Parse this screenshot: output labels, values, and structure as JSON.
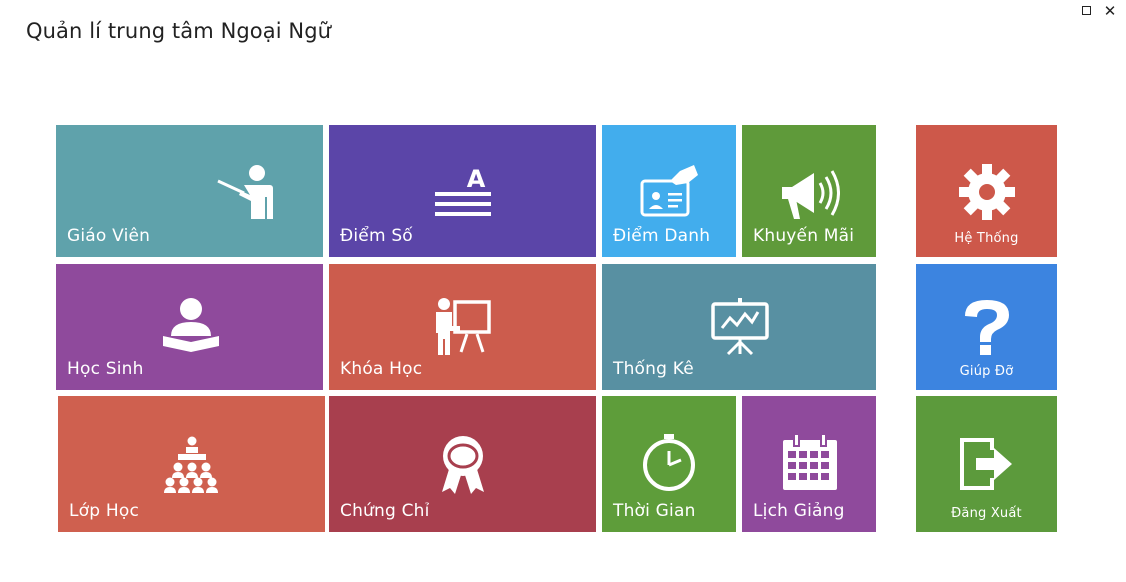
{
  "window": {
    "title": "Quản lí trung tâm Ngoại Ngữ"
  },
  "tiles": {
    "giao_vien": {
      "label": "Giáo Viên",
      "color": "#5fa2ab"
    },
    "diem_so": {
      "label": "Điểm Số",
      "color": "#5b45a8"
    },
    "diem_danh": {
      "label": "Điểm Danh",
      "color": "#42aded"
    },
    "khuyen_mai": {
      "label": "Khuyến Mãi",
      "color": "#5f9a3a"
    },
    "he_thong": {
      "label": "Hệ Thống",
      "color": "#cd584a"
    },
    "hoc_sinh": {
      "label": "Học Sinh",
      "color": "#8f4a9c"
    },
    "khoa_hoc": {
      "label": "Khóa Học",
      "color": "#cc5c4d"
    },
    "thong_ke": {
      "label": "Thống Kê",
      "color": "#5890a2"
    },
    "giup_do": {
      "label": "Giúp Đỡ",
      "color": "#3c84e0"
    },
    "lop_hoc": {
      "label": "Lớp Học",
      "color": "#cf604f"
    },
    "chung_chi": {
      "label": "Chứng Chỉ",
      "color": "#a83f4e"
    },
    "thoi_gian": {
      "label": "Thời Gian",
      "color": "#5e9d3a"
    },
    "lich_giang": {
      "label": "Lịch Giảng",
      "color": "#8f4a9c"
    },
    "dang_xuat": {
      "label": "Đăng Xuất",
      "color": "#5c9a3c"
    }
  },
  "icons": {
    "giao_vien": "teacher-icon",
    "diem_so": "grades-icon",
    "diem_danh": "attendance-card-icon",
    "khuyen_mai": "megaphone-icon",
    "he_thong": "gear-icon",
    "hoc_sinh": "student-reading-icon",
    "khoa_hoc": "presentation-board-icon",
    "thong_ke": "chart-board-icon",
    "giup_do": "question-icon",
    "lop_hoc": "classroom-icon",
    "chung_chi": "certificate-badge-icon",
    "thoi_gian": "clock-icon",
    "lich_giang": "calendar-icon",
    "dang_xuat": "logout-icon"
  }
}
